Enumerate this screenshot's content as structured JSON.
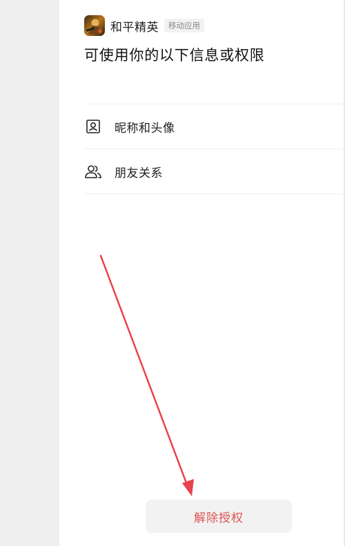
{
  "app": {
    "name": "和平精英",
    "tag": "移动应用",
    "icon": "game-app-icon"
  },
  "title": "可使用你的以下信息或权限",
  "permissions": [
    {
      "label": "昵称和头像",
      "icon": "profile-card-icon"
    },
    {
      "label": "朋友关系",
      "icon": "friends-icon"
    }
  ],
  "revoke_button": {
    "label": "解除授权",
    "color": "#e05252"
  },
  "annotation": {
    "arrow_color": "#e8434b"
  },
  "colors": {
    "side_panel": "#efefef",
    "tag_background": "#f2f2f2",
    "button_background": "#f2f2f2"
  }
}
